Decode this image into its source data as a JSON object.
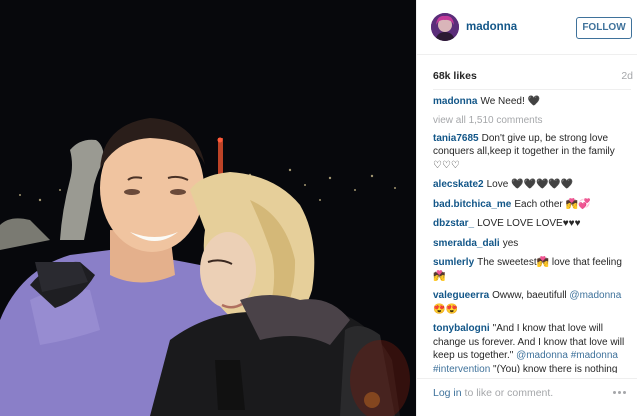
{
  "post": {
    "username": "madonna",
    "follow_label": "FOLLOW",
    "likes": "68k likes",
    "age": "2d",
    "view_all": "view all 1,510 comments",
    "footer": {
      "link_text": "Log in",
      "rest_text": " to like or comment."
    }
  },
  "comments": [
    {
      "user": "madonna",
      "text": "We Need! 🖤"
    },
    {
      "user": "tania7685",
      "text": "Don't give up, be strong love conquers all,keep it together in the family ♡♡♡"
    },
    {
      "user": "alecskate2",
      "text": "Love 🖤🖤🖤🖤🖤"
    },
    {
      "user": "bad.bitchica_me",
      "text": "Each other 💏💞"
    },
    {
      "user": "dbzstar_",
      "text": "LOVE LOVE LOVE♥♥♥"
    },
    {
      "user": "smeralda_dali",
      "text": "yes"
    },
    {
      "user": "sumlerly",
      "text": "The sweetest💏 love that feeling💏"
    },
    {
      "user": "valegueerra",
      "text": "Owww, baeutifull",
      "mention": "@madonna",
      "suffix": " 😍😍"
    },
    {
      "user": "tonybalogni",
      "text": "\"And I know that love will change us forever. And I know that love will keep us together.\"",
      "mention": "@madonna #madonna #intervention",
      "suffix": " \"(You) know there is nothing to fear. And (you) know love will take (you) away from here!\""
    }
  ],
  "colors": {
    "username": "#125688",
    "follow": "#3f729b",
    "muted": "#a5a7aa",
    "text": "#262626"
  },
  "icons": {
    "more": "more-dots-icon"
  }
}
